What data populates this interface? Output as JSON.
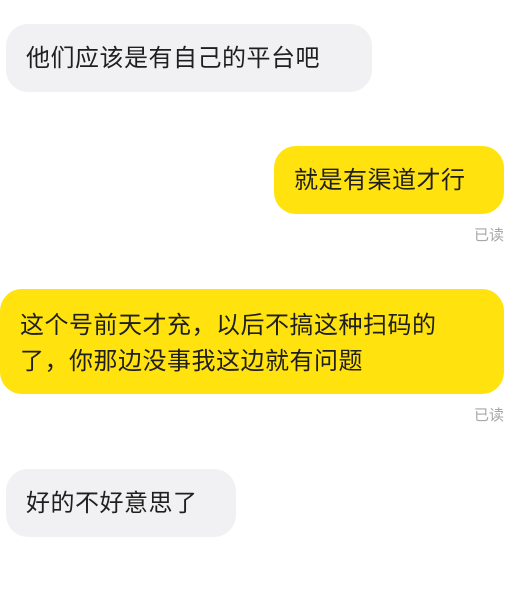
{
  "messages": [
    {
      "direction": "incoming",
      "text": "他们应该是有自己的平台吧"
    },
    {
      "direction": "outgoing",
      "text": "就是有渠道才行",
      "status": "已读"
    },
    {
      "direction": "outgoing",
      "text": "这个号前天才充，以后不搞这种扫码的了，你那边没事我这边就有问题",
      "status": "已读"
    },
    {
      "direction": "incoming",
      "text": "好的不好意思了"
    }
  ],
  "colors": {
    "incoming_bubble": "#f1f1f3",
    "outgoing_bubble": "#ffe20e",
    "read_status": "#a7a7a7",
    "text": "#1f1f1f"
  }
}
